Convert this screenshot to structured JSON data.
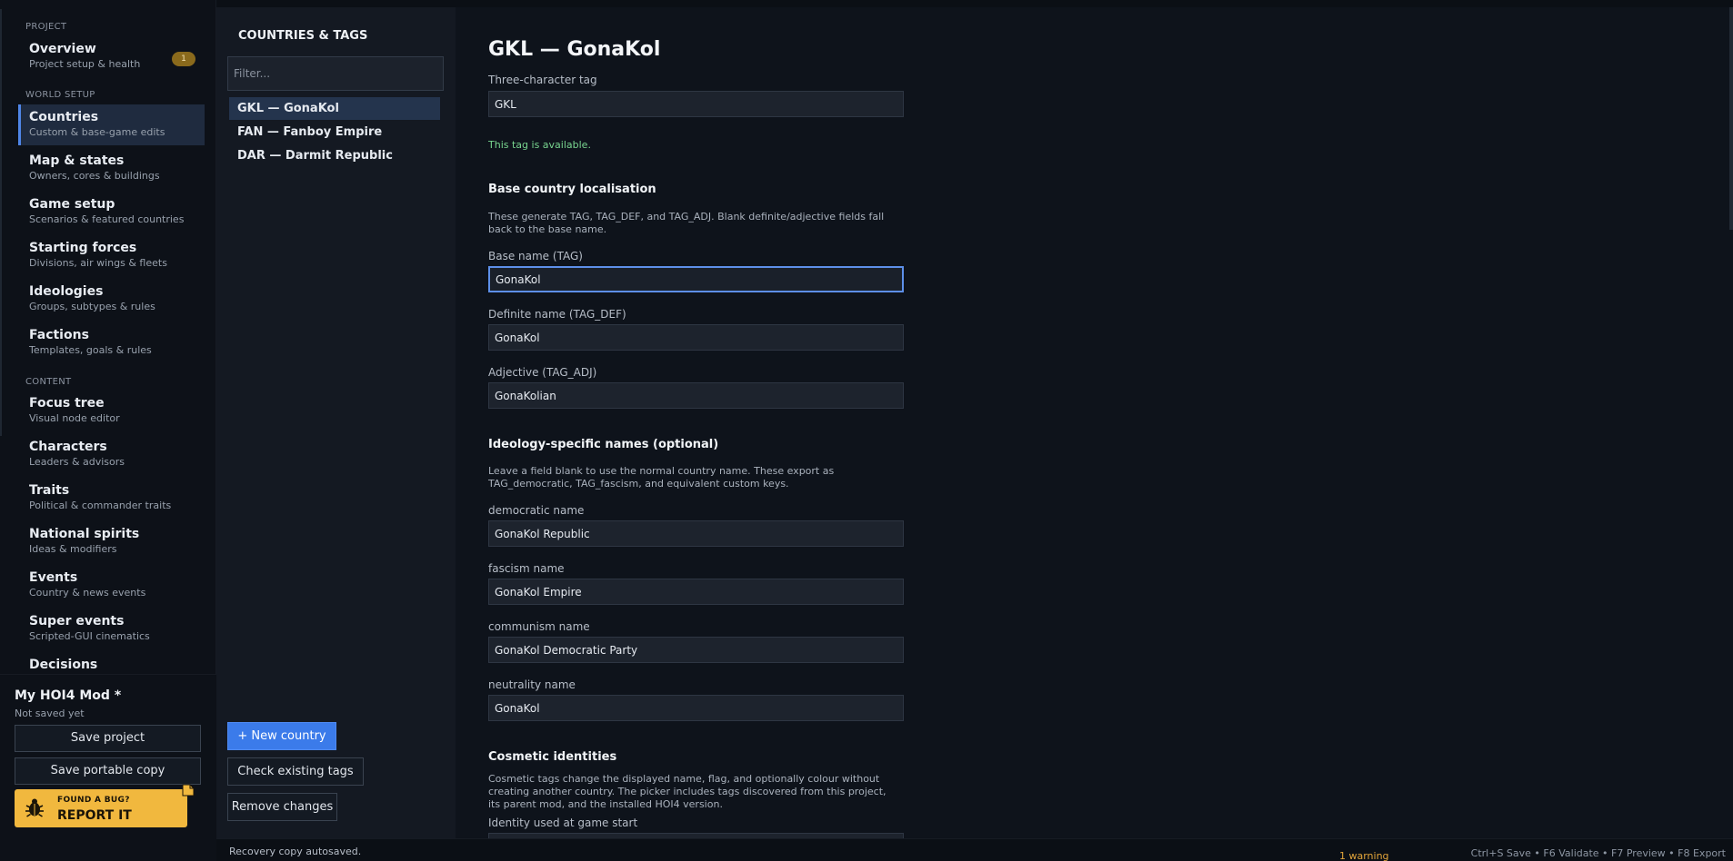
{
  "sidebar": {
    "sections": {
      "project": "PROJECT",
      "world_setup": "WORLD SETUP",
      "content": "CONTENT"
    },
    "items": [
      {
        "title": "Overview",
        "subtitle": "Project setup & health",
        "badge": "1"
      },
      {
        "title": "Countries",
        "subtitle": "Custom & base-game edits"
      },
      {
        "title": "Map & states",
        "subtitle": "Owners, cores & buildings"
      },
      {
        "title": "Game setup",
        "subtitle": "Scenarios & featured countries"
      },
      {
        "title": "Starting forces",
        "subtitle": "Divisions, air wings & fleets"
      },
      {
        "title": "Ideologies",
        "subtitle": "Groups, subtypes & rules"
      },
      {
        "title": "Factions",
        "subtitle": "Templates, goals & rules"
      },
      {
        "title": "Focus tree",
        "subtitle": "Visual node editor"
      },
      {
        "title": "Characters",
        "subtitle": "Leaders & advisors"
      },
      {
        "title": "Traits",
        "subtitle": "Political & commander traits"
      },
      {
        "title": "National spirits",
        "subtitle": "Ideas & modifiers"
      },
      {
        "title": "Events",
        "subtitle": "Country & news events"
      },
      {
        "title": "Super events",
        "subtitle": "Scripted-GUI cinematics"
      },
      {
        "title": "Decisions",
        "subtitle": ""
      }
    ],
    "active_item": "Countries"
  },
  "project": {
    "name": "My HOI4 Mod *",
    "status": "Not saved yet",
    "save_label": "Save project",
    "save_portable_label": "Save portable copy",
    "bug_small": "FOUND A BUG?",
    "bug_big": "REPORT IT"
  },
  "list_panel": {
    "heading": "COUNTRIES & TAGS",
    "filter_placeholder": "Filter...",
    "countries": [
      {
        "label": "GKL — GonaKol",
        "selected": true
      },
      {
        "label": "FAN — Fanboy Empire",
        "selected": false
      },
      {
        "label": "DAR — Darmit Republic",
        "selected": false
      }
    ],
    "new_country_label": "+ New country",
    "check_tags_label": "Check existing tags",
    "remove_changes_label": "Remove changes"
  },
  "editor": {
    "title": "GKL — GonaKol",
    "tag_label": "Three-character tag",
    "tag_value": "GKL",
    "tag_available": "This tag is available.",
    "localisation": {
      "title": "Base country localisation",
      "help": "These generate TAG, TAG_DEF, and TAG_ADJ. Blank definite/adjective fields fall back to the base name.",
      "base_label": "Base name (TAG)",
      "base_value": "GonaKol",
      "def_label": "Definite name (TAG_DEF)",
      "def_value": "GonaKol",
      "adj_label": "Adjective (TAG_ADJ)",
      "adj_value": "GonaKolian"
    },
    "ideology_names": {
      "title": "Ideology-specific names (optional)",
      "help": "Leave a field blank to use the normal country name. These export as TAG_democratic, TAG_fascism, and equivalent custom keys.",
      "fields": [
        {
          "label": "democratic name",
          "value": "GonaKol Republic"
        },
        {
          "label": "fascism name",
          "value": "GonaKol Empire"
        },
        {
          "label": "communism name",
          "value": "GonaKol Democratic Party"
        },
        {
          "label": "neutrality name",
          "value": "GonaKol"
        }
      ]
    },
    "cosmetic": {
      "title": "Cosmetic identities",
      "help": "Cosmetic tags change the displayed name, flag, and optionally colour without creating another country. The picker includes tags discovered from this project, its parent mod, and the installed HOI4 version.",
      "identity_label": "Identity used at game start"
    }
  },
  "statusbar": {
    "left": "Recovery copy autosaved.",
    "warning": "1 warning",
    "shortcuts": "Ctrl+S Save  •  F6 Validate  •  F7 Preview  •  F8 Export"
  },
  "colors": {
    "accent": "#3b7bea",
    "active_nav": "#1f2b3f",
    "success": "#78d48f",
    "warning": "#e3a53a",
    "bug_card": "#f1b83e"
  }
}
